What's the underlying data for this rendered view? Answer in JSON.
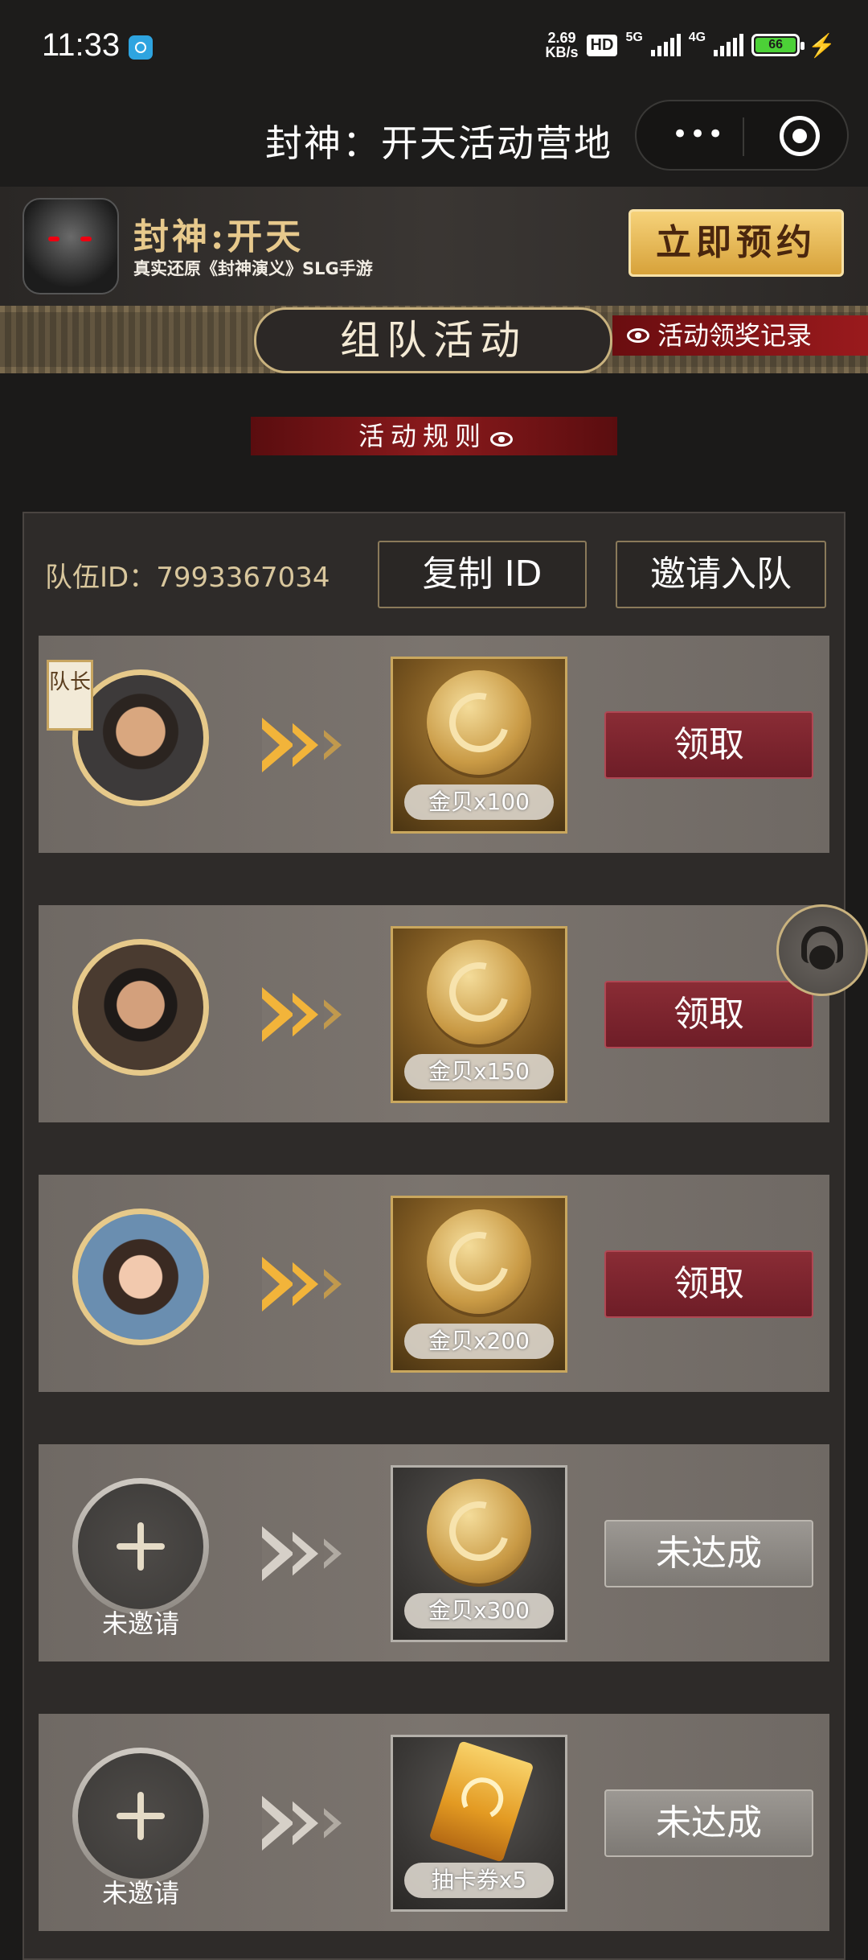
{
  "status_bar": {
    "time": "11:33",
    "net_speed_value": "2.69",
    "net_speed_unit": "KB/s",
    "hd": "HD",
    "net_5g": "5G",
    "net_4g": "4G",
    "battery": "66",
    "battery_level": 0.66
  },
  "title_bar": {
    "title": "封神：开天活动营地",
    "more_icon": "more-dots-icon",
    "close_icon": "target-circle-icon"
  },
  "banner": {
    "game_name": "封神:开天",
    "subtitle": "真实还原《封神演义》SLG手游",
    "reserve_button": "立即预约"
  },
  "section": {
    "title": "组队活动",
    "records_link": "活动领奖记录",
    "rules_button": "活动规则"
  },
  "team": {
    "id_label": "队伍ID：7993367034",
    "copy_button": "复制 ID",
    "invite_button": "邀请入队"
  },
  "rows": [
    {
      "leader_badge": "队长",
      "reward_label": "金贝x100",
      "action": "领取",
      "state": "claimable"
    },
    {
      "reward_label": "金贝x150",
      "action": "领取",
      "state": "claimable"
    },
    {
      "reward_label": "金贝x200",
      "action": "领取",
      "state": "claimable"
    },
    {
      "invite_label": "未邀请",
      "reward_label": "金贝x300",
      "action": "未达成",
      "state": "locked"
    },
    {
      "invite_label": "未邀请",
      "reward_label": "抽卡券x5",
      "action": "未达成",
      "state": "locked"
    }
  ],
  "colors": {
    "background": "#1b1a19",
    "gold_accent": "#e7c98c",
    "claim_button": "#7a2430",
    "locked_button": "#8a8680",
    "red_ribbon": "#8a1a1c"
  }
}
